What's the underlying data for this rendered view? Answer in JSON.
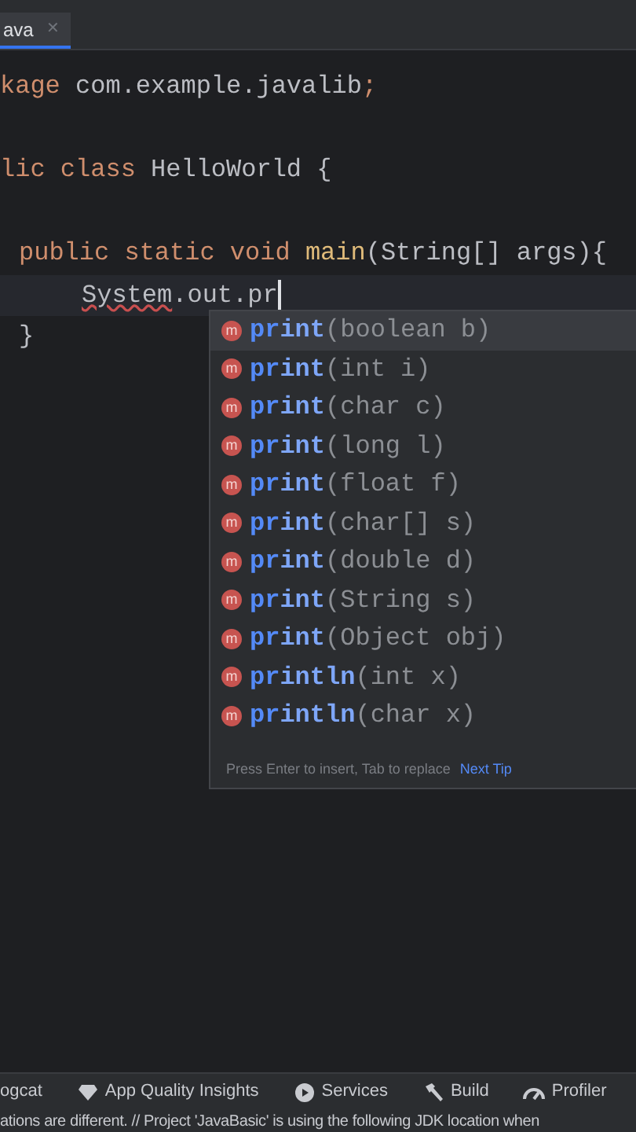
{
  "tab": {
    "label": "ava",
    "close": "✕",
    "selected": true
  },
  "code_lines": [
    {
      "kind": "top",
      "tokens": [
        {
          "kind": "keyword",
          "text": "kage"
        },
        {
          "kind": "plain",
          "text": " com.example.javalib"
        },
        {
          "kind": "keyword",
          "text": ";"
        }
      ]
    },
    {
      "kind": "blank"
    },
    {
      "kind": "top",
      "tokens": [
        {
          "kind": "keyword",
          "text": "lic class "
        },
        {
          "kind": "plain",
          "text": "HelloWorld {"
        }
      ]
    },
    {
      "kind": "blank"
    },
    {
      "kind": "member",
      "tokens": [
        {
          "kind": "keyword",
          "text": "public static void "
        },
        {
          "kind": "method",
          "text": "main"
        },
        {
          "kind": "plain",
          "text": "(String[] args){"
        }
      ]
    },
    {
      "kind": "body",
      "current": true,
      "caret": true,
      "tokens": [
        {
          "kind": "error",
          "text": "System"
        },
        {
          "kind": "plain",
          "text": ".out.pr"
        }
      ]
    },
    {
      "kind": "member",
      "tokens": [
        {
          "kind": "plain",
          "text": "}"
        }
      ]
    }
  ],
  "completion": {
    "items": [
      {
        "icon": "m",
        "match": "pr",
        "rest": "int",
        "params": "(boolean b)",
        "selected": true
      },
      {
        "icon": "m",
        "match": "pr",
        "rest": "int",
        "params": "(int i)",
        "selected": false
      },
      {
        "icon": "m",
        "match": "pr",
        "rest": "int",
        "params": "(char c)",
        "selected": false
      },
      {
        "icon": "m",
        "match": "pr",
        "rest": "int",
        "params": "(long l)",
        "selected": false
      },
      {
        "icon": "m",
        "match": "pr",
        "rest": "int",
        "params": "(float f)",
        "selected": false
      },
      {
        "icon": "m",
        "match": "pr",
        "rest": "int",
        "params": "(char[] s)",
        "selected": false
      },
      {
        "icon": "m",
        "match": "pr",
        "rest": "int",
        "params": "(double d)",
        "selected": false
      },
      {
        "icon": "m",
        "match": "pr",
        "rest": "int",
        "params": "(String s)",
        "selected": false
      },
      {
        "icon": "m",
        "match": "pr",
        "rest": "int",
        "params": "(Object obj)",
        "selected": false
      },
      {
        "icon": "m",
        "match": "pr",
        "rest": "intln",
        "params": "(int x)",
        "selected": false
      },
      {
        "icon": "m",
        "match": "pr",
        "rest": "intln",
        "params": "(char x)",
        "selected": false
      }
    ],
    "hint": "Press Enter to insert, Tab to replace",
    "link": "Next Tip"
  },
  "tool_windows": [
    {
      "kind": "none",
      "label": "ogcat"
    },
    {
      "kind": "gem",
      "label": "App Quality Insights"
    },
    {
      "kind": "play",
      "label": "Services"
    },
    {
      "kind": "hammer",
      "label": "Build"
    },
    {
      "kind": "gauge",
      "label": "Profiler"
    }
  ],
  "status_bar": "ations are different. // Project 'JavaBasic' is using the following JDK location when"
}
